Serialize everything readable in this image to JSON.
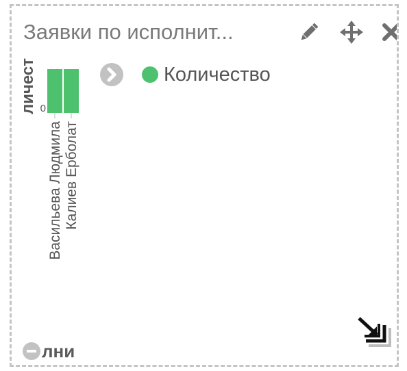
{
  "widget": {
    "title": "Заявки по исполнит...",
    "edit_icon": "pencil-icon",
    "move_icon": "move-arrows-icon",
    "close_icon": "close-icon",
    "resize_icon": "resize-corner-icon",
    "expand_icon": "chevron-right-icon"
  },
  "colors": {
    "series": "#4ec16e",
    "border": "#c4c4c4",
    "title": "#7a7a7a",
    "icon": "#6f6f6f"
  },
  "bottom_control": {
    "label": "лни",
    "icon": "minus-circle-icon"
  },
  "chart_data": {
    "type": "bar",
    "title": "",
    "ylabel": "личест",
    "categories": [
      "Васильева Людмила",
      "Калиев Ерболат"
    ],
    "series": [
      {
        "name": "Количество",
        "values": [
          1,
          1
        ]
      }
    ],
    "ylim": [
      0,
      1
    ],
    "y_ticks": [
      "0"
    ],
    "legend": "top-right",
    "grid": false
  }
}
